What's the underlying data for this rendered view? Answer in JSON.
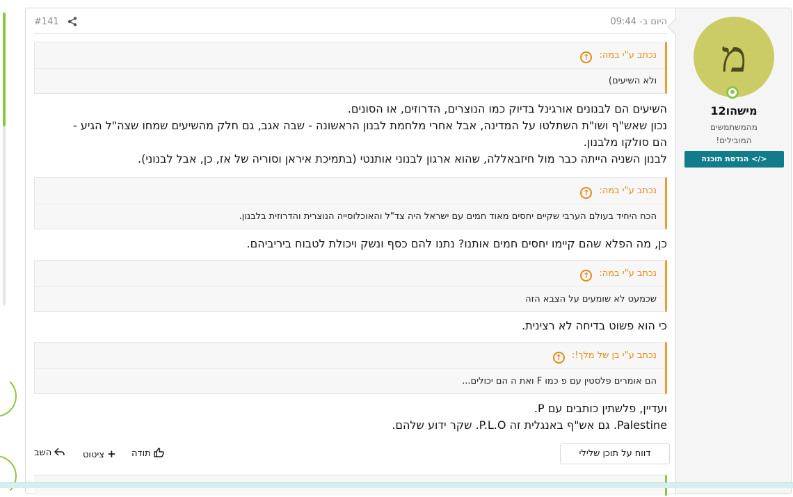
{
  "post": {
    "number": "#141",
    "date": "היום ב- 09:44",
    "share_icon": "share-icon"
  },
  "user": {
    "avatar_letter": "מ",
    "name": "מישהו12",
    "title_line1": "מהמשתמשים",
    "title_line2": "המובילים!",
    "banner": "הנדסת תוכנה",
    "avatar_color": "#cccc66",
    "online_color": "#8bc34a",
    "banner_color": "#127c8a"
  },
  "quotes": [
    {
      "header": "נכתב ע\"י במה:",
      "body": "ולא השיעים)"
    },
    {
      "header": "נכתב ע\"י במה:",
      "body": "הכח היחיד בעולם הערבי שקיים יחסים מאוד חמים עם ישראל היה צד\"ל והאוכלוסייה הנוצרית והדרוזית בלבנון."
    },
    {
      "header": "נכתב ע\"י במה:",
      "body": "שכמעט לא שומעים על הצבא הזה"
    },
    {
      "header": "נכתב ע\"י בן של מלך!:",
      "body": "הם אומרים פלסטין עם פ כמו F ואת ה הם יכולים..."
    }
  ],
  "paragraphs": {
    "p1_line1": "השיעים הם לבנונים אורגינל בדיוק כמו הנוצרים, הדרוזים, או הסונים.",
    "p1_line2": "נכון שאש\"ף ושו\"ת השתלטו על המדינה, אבל אחרי מלחמת לבנון הראשונה - שבה אגב, גם חלק מהשיעים שמחו שצה\"ל הגיע -",
    "p1_line3": "הם סולקו מלבנון.",
    "p1_line4": "לבנון השניה הייתה כבר מול חיזבאללה, שהוא ארגון לבנוני אותנטי (בתמיכת איראן וסוריה של אז, כן, אבל לבנוני).",
    "p2": "כן, מה הפלא שהם קיימו יחסים חמים אותנו? נתנו להם כסף ונשק ויכולת לטבוח ביריביהם.",
    "p3": "כי הוא פשוט בדיחה לא רצינית.",
    "p4_line1": "ועדיין, פלשתין כותבים עם P.",
    "p4_line2": "Palestine. גם אש\"ף באנגלית זה P.L.O. שקר ידוע שלהם."
  },
  "actions": {
    "report": "דווח על תוכן שלילי",
    "like": "תודה",
    "quote": "ציטוט",
    "reply": "השב"
  },
  "colors": {
    "quote_accent": "#f29b2c",
    "scroll_accent": "#8cc63f"
  }
}
